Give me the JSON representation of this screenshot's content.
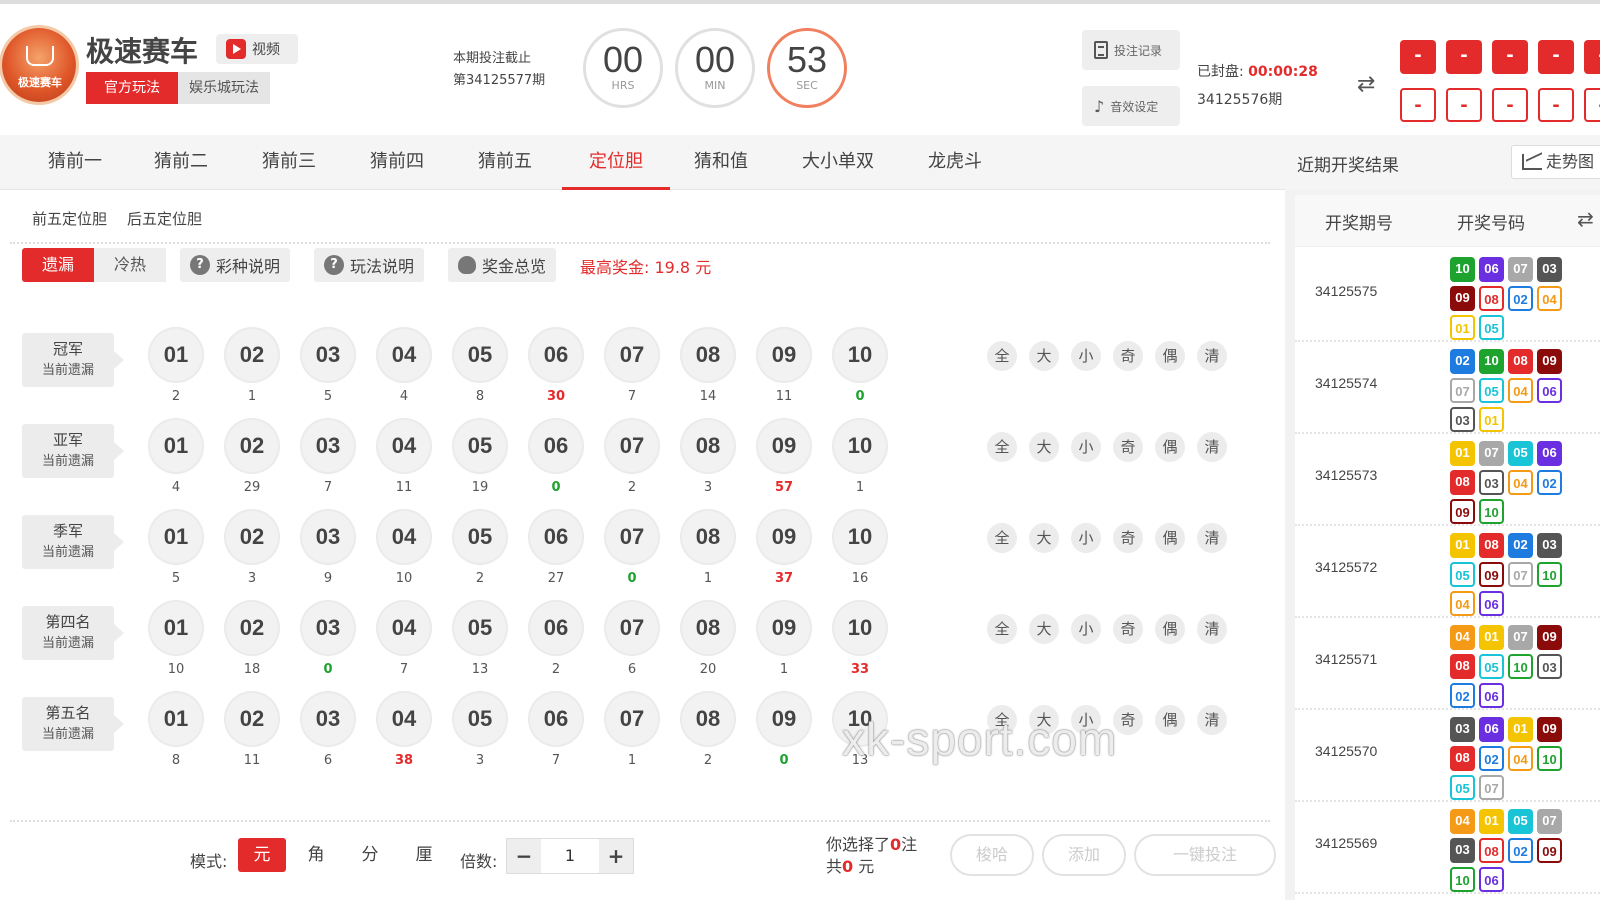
{
  "header": {
    "game_title": "极速赛车",
    "video_label": "视频",
    "mode_tabs": [
      "官方玩法",
      "娱乐城玩法"
    ],
    "deadline_label": "本期投注截止",
    "deadline_issue": "第34125577期",
    "countdown": [
      {
        "value": "00",
        "unit": "HRS"
      },
      {
        "value": "00",
        "unit": "MIN"
      },
      {
        "value": "53",
        "unit": "SEC"
      }
    ],
    "bet_record_label": "投注记录",
    "sound_label": "音效设定",
    "sealed_label": "已封盘:",
    "sealed_timer": "00:00:28",
    "sealed_issue": "34125576期",
    "result_top": [
      "-",
      "-",
      "-",
      "-",
      "-"
    ],
    "result_bottom": [
      "-",
      "-",
      "-",
      "-",
      "-"
    ]
  },
  "nav": {
    "tabs": [
      "猜前一",
      "猜前二",
      "猜前三",
      "猜前四",
      "猜前五",
      "定位胆",
      "猜和值",
      "大小单双",
      "龙虎斗"
    ],
    "active": "定位胆"
  },
  "main": {
    "sub_tabs": [
      "前五定位胆",
      "后五定位胆"
    ],
    "toggle": [
      "遗漏",
      "冷热"
    ],
    "info_buttons": [
      "彩种说明",
      "玩法说明",
      "奖金总览"
    ],
    "max_prize": "最高奖金: 19.8 元",
    "balls": [
      "01",
      "02",
      "03",
      "04",
      "05",
      "06",
      "07",
      "08",
      "09",
      "10"
    ],
    "quick_picks": [
      "全",
      "大",
      "小",
      "奇",
      "偶",
      "清"
    ],
    "positions": [
      {
        "name": "冠军",
        "sub": "当前遗漏",
        "omits": [
          "2",
          "1",
          "5",
          "4",
          "8",
          "30",
          "7",
          "14",
          "11",
          "0"
        ]
      },
      {
        "name": "亚军",
        "sub": "当前遗漏",
        "omits": [
          "4",
          "29",
          "7",
          "11",
          "19",
          "0",
          "2",
          "3",
          "57",
          "1"
        ]
      },
      {
        "name": "季军",
        "sub": "当前遗漏",
        "omits": [
          "5",
          "3",
          "9",
          "10",
          "2",
          "27",
          "0",
          "1",
          "37",
          "16"
        ]
      },
      {
        "name": "第四名",
        "sub": "当前遗漏",
        "omits": [
          "10",
          "18",
          "0",
          "7",
          "13",
          "2",
          "6",
          "20",
          "1",
          "33"
        ]
      },
      {
        "name": "第五名",
        "sub": "当前遗漏",
        "omits": [
          "8",
          "11",
          "6",
          "38",
          "3",
          "7",
          "1",
          "2",
          "0",
          "13"
        ]
      }
    ],
    "hot_cells": [
      [
        0,
        5
      ],
      [
        1,
        8
      ],
      [
        2,
        8
      ],
      [
        3,
        9
      ],
      [
        4,
        3
      ]
    ],
    "zero_cells": [
      [
        0,
        9
      ],
      [
        1,
        5
      ],
      [
        2,
        6
      ],
      [
        3,
        2
      ],
      [
        4,
        8
      ]
    ]
  },
  "bottom": {
    "mode_label": "模式:",
    "units": [
      "元",
      "角",
      "分",
      "厘"
    ],
    "multiplier_label": "倍数:",
    "multiplier_value": "1",
    "minus": "−",
    "plus": "+",
    "selected_prefix": "你选择了",
    "selected_count": "0",
    "selected_suffix": "注",
    "total_prefix": "共",
    "total_amount": "0",
    "total_suffix": " 元",
    "buttons": [
      "梭哈",
      "添加",
      "一键投注"
    ]
  },
  "right_panel": {
    "title": "近期开奖结果",
    "trend_label": "走势图",
    "col_issue": "开奖期号",
    "col_numbers": "开奖号码",
    "draws": [
      {
        "issue": "34125575",
        "numbers": [
          "10",
          "06",
          "07",
          "03",
          "09",
          "08",
          "02",
          "04",
          "01",
          "05"
        ]
      },
      {
        "issue": "34125574",
        "numbers": [
          "02",
          "10",
          "08",
          "09",
          "07",
          "05",
          "04",
          "06",
          "03",
          "01"
        ]
      },
      {
        "issue": "34125573",
        "numbers": [
          "01",
          "07",
          "05",
          "06",
          "08",
          "03",
          "04",
          "02",
          "09",
          "10"
        ]
      },
      {
        "issue": "34125572",
        "numbers": [
          "01",
          "08",
          "02",
          "03",
          "05",
          "09",
          "07",
          "10",
          "04",
          "06"
        ]
      },
      {
        "issue": "34125571",
        "numbers": [
          "04",
          "01",
          "07",
          "09",
          "08",
          "05",
          "10",
          "03",
          "02",
          "06"
        ]
      },
      {
        "issue": "34125570",
        "numbers": [
          "03",
          "06",
          "01",
          "09",
          "08",
          "02",
          "04",
          "10",
          "05",
          "07"
        ]
      },
      {
        "issue": "34125569",
        "numbers": [
          "04",
          "01",
          "05",
          "07",
          "03",
          "08",
          "02",
          "09",
          "10",
          "06"
        ]
      }
    ],
    "number_colors": {
      "01": "#f5c400",
      "02": "#1e7be0",
      "03": "#555555",
      "04": "#f59a16",
      "05": "#18c4d6",
      "06": "#6a2fe0",
      "07": "#a8a8a8",
      "08": "#e42b2b",
      "09": "#8b0a0a",
      "10": "#1ea32f"
    }
  },
  "watermark": "xk-sport.com",
  "colors": {
    "accent": "#e42b2b",
    "zero": "#1ea32f"
  }
}
